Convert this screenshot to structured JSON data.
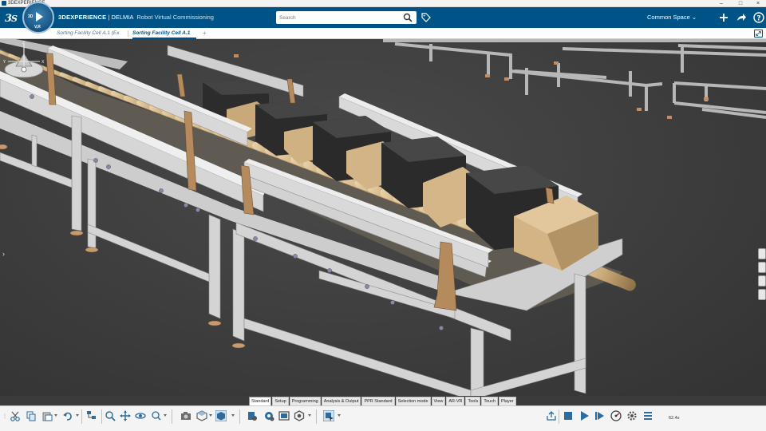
{
  "window": {
    "title": "3DEXPERIENCE"
  },
  "header": {
    "brand_bold": "3DEXPERIENCE",
    "brand_rest": " | DELMIA",
    "app_role": "Robot Virtual Commissioning",
    "compass_v": "V,R",
    "compass_3d": "3D",
    "search_placeholder": "Search",
    "space": "Common Space"
  },
  "tabs": [
    {
      "label": "Sorting Facility Cell A.1 (Ex",
      "active": false
    },
    {
      "label": "Sorting Facility Cell A.1",
      "active": true
    }
  ],
  "section_tabs": [
    {
      "label": "Standard",
      "active": true
    },
    {
      "label": "Setup"
    },
    {
      "label": "Programming"
    },
    {
      "label": "Analysis & Output"
    },
    {
      "label": "PPR Standard"
    },
    {
      "label": "Selection mode"
    },
    {
      "label": "View"
    },
    {
      "label": "AR-VR"
    },
    {
      "label": "Tools"
    },
    {
      "label": "Touch"
    },
    {
      "label": "Player"
    }
  ],
  "player": {
    "time": "62.4s"
  },
  "compass_axes": {
    "x": "X",
    "y": "Y",
    "z": "Z"
  },
  "colors": {
    "brand_blue": "#005386",
    "box_brown": "#d4b98a",
    "box_black": "#2f2f2f",
    "frame_grey": "#cfcfcf"
  },
  "icons": [
    "ds-logo-icon",
    "compass-play-icon",
    "search-icon",
    "tag-icon",
    "add-icon",
    "share-icon",
    "help-icon",
    "maximize-icon",
    "cut-icon",
    "copy-icon",
    "paste-icon",
    "undo-icon",
    "tree-icon",
    "zoom-icon",
    "pan-icon",
    "rotate-icon",
    "fly-icon",
    "capture-icon",
    "render-icon",
    "view-cube-icon",
    "layer-icon",
    "rotate-object-icon",
    "snapshot-icon",
    "settings-hex-icon",
    "select-icon",
    "export-icon",
    "stop-icon",
    "play-icon",
    "step-icon",
    "speed-icon",
    "gear-icon",
    "list-icon"
  ]
}
